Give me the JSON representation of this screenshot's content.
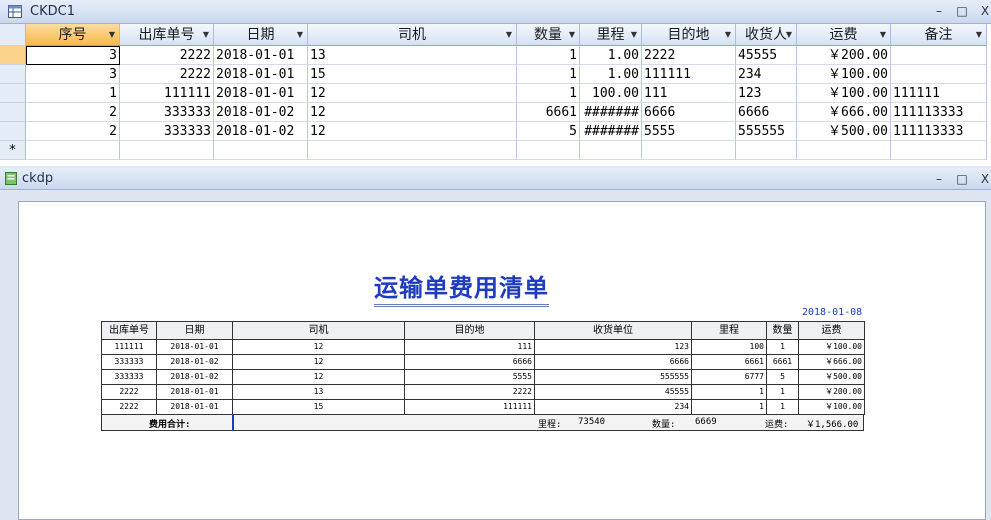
{
  "datasheet": {
    "title": "CKDC1",
    "window_buttons": {
      "min": "–",
      "max": "□",
      "close": "X"
    },
    "columns": [
      "序号",
      "出库单号",
      "日期",
      "司机",
      "数量",
      "里程",
      "目的地",
      "收货人",
      "运费",
      "备注"
    ],
    "rows": [
      [
        "3",
        "2222",
        "2018-01-01",
        "13",
        "1",
        "1.00",
        "2222",
        "45555",
        "￥200.00",
        ""
      ],
      [
        "3",
        "2222",
        "2018-01-01",
        "15",
        "1",
        "1.00",
        "111111",
        "234",
        "￥100.00",
        ""
      ],
      [
        "1",
        "111111",
        "2018-01-01",
        "12",
        "1",
        "100.00",
        "111",
        "123",
        "￥100.00",
        "111111"
      ],
      [
        "2",
        "333333",
        "2018-01-02",
        "12",
        "6661",
        "#######",
        "6666",
        "6666",
        "￥666.00",
        "111113333"
      ],
      [
        "2",
        "333333",
        "2018-01-02",
        "12",
        "5",
        "#######",
        "5555",
        "555555",
        "￥500.00",
        "111113333"
      ]
    ],
    "new_row_marker": "*"
  },
  "report_window": {
    "title": "ckdp",
    "window_buttons": {
      "min": "–",
      "max": "□",
      "close": "X"
    }
  },
  "report": {
    "title": "运输单费用清单",
    "date": "2018-01-08",
    "columns": [
      "出库单号",
      "日期",
      "司机",
      "目的地",
      "收货单位",
      "里程",
      "数量",
      "运费"
    ],
    "rows": [
      [
        "111111",
        "2018-01-01",
        "12",
        "111",
        "123",
        "100",
        "1",
        "￥100.00"
      ],
      [
        "333333",
        "2018-01-02",
        "12",
        "6666",
        "6666",
        "6661",
        "6661",
        "￥666.00"
      ],
      [
        "333333",
        "2018-01-02",
        "12",
        "5555",
        "555555",
        "6777",
        "5",
        "￥500.00"
      ],
      [
        "2222",
        "2018-01-01",
        "13",
        "2222",
        "45555",
        "1",
        "1",
        "￥200.00"
      ],
      [
        "2222",
        "2018-01-01",
        "15",
        "111111",
        "234",
        "1",
        "1",
        "￥100.00"
      ]
    ],
    "footer": {
      "label": "费用合计:",
      "mileage_label": "里程:",
      "mileage_value": "73540",
      "qty_label": "数量:",
      "qty_value": "6669",
      "fee_label": "运费:",
      "fee_value": "￥1,566.00"
    }
  }
}
